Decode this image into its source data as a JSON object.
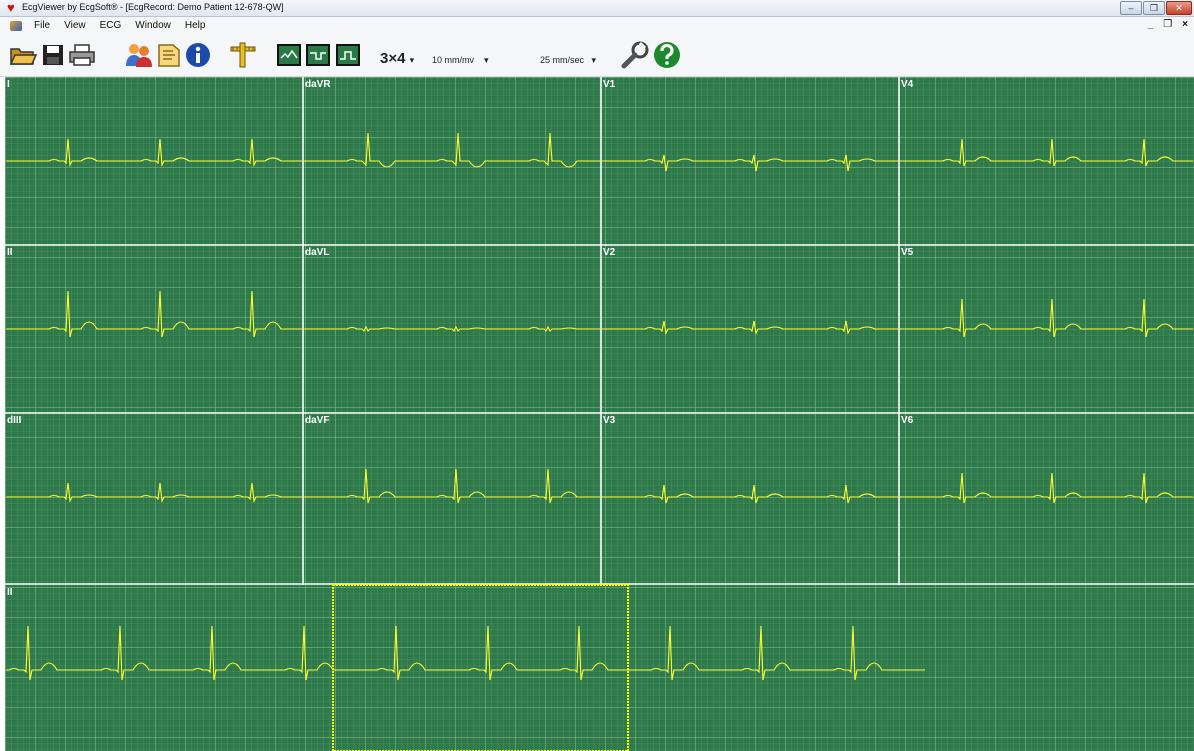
{
  "window": {
    "title": "EcgViewer by EcgSoft® - [EcgRecord: Demo Patient 12-678-QW]",
    "min_label": "‒",
    "max_label": "❐",
    "close_label": "✕"
  },
  "menu": {
    "items": [
      "File",
      "View",
      "ECG",
      "Window",
      "Help"
    ],
    "mdi_min": "_",
    "mdi_restore": "❐",
    "mdi_close": "×"
  },
  "toolbar": {
    "layout": "3×4",
    "layout_arrow": "▾",
    "gain": "10 mm/mv",
    "gain_arrow": "▾",
    "speed": "25 mm/sec",
    "speed_arrow": "▾"
  },
  "colors": {
    "grid_bg": "#2f7a4b",
    "trace": "#ffff33",
    "selection": "#ffff00"
  },
  "leads": [
    {
      "name": "I",
      "row": 0,
      "col": 0
    },
    {
      "name": "daVR",
      "row": 0,
      "col": 1
    },
    {
      "name": "V1",
      "row": 0,
      "col": 2
    },
    {
      "name": "V4",
      "row": 0,
      "col": 3
    },
    {
      "name": "II",
      "row": 1,
      "col": 0
    },
    {
      "name": "daVL",
      "row": 1,
      "col": 1
    },
    {
      "name": "V2",
      "row": 1,
      "col": 2
    },
    {
      "name": "V5",
      "row": 1,
      "col": 3
    },
    {
      "name": "dIII",
      "row": 2,
      "col": 0
    },
    {
      "name": "daVF",
      "row": 2,
      "col": 1
    },
    {
      "name": "V3",
      "row": 2,
      "col": 2
    },
    {
      "name": "V6",
      "row": 2,
      "col": 3
    }
  ],
  "rhythm_strip": {
    "name": "II"
  }
}
